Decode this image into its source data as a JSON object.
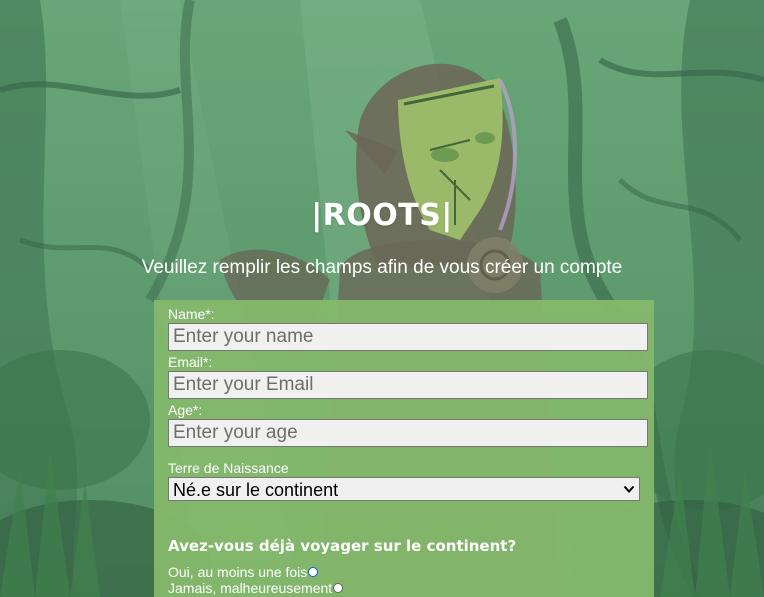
{
  "page": {
    "title": "|ROOTS|",
    "subtitle": "Veuillez remplir les champs afin de vous créer un compte"
  },
  "form": {
    "name_label": "Name*:",
    "name_placeholder": "Enter your name",
    "email_label": "Email*:",
    "email_placeholder": "Enter your Email",
    "age_label": "Age*:",
    "age_placeholder": "Enter your age",
    "birthplace_label": "Terre de Naissance",
    "birthplace_selected": "Né.e sur le continent",
    "question": "Avez-vous déjà voyager sur le continent?",
    "options": [
      {
        "label": "Oui, au moins une fois"
      },
      {
        "label": "Jamais, malheureusement"
      }
    ]
  },
  "colors": {
    "background": "#5f9a6b",
    "form_panel": "#84b86c",
    "text": "#ffffff"
  },
  "icons": {
    "select_chevron": "chevron-down-icon"
  }
}
